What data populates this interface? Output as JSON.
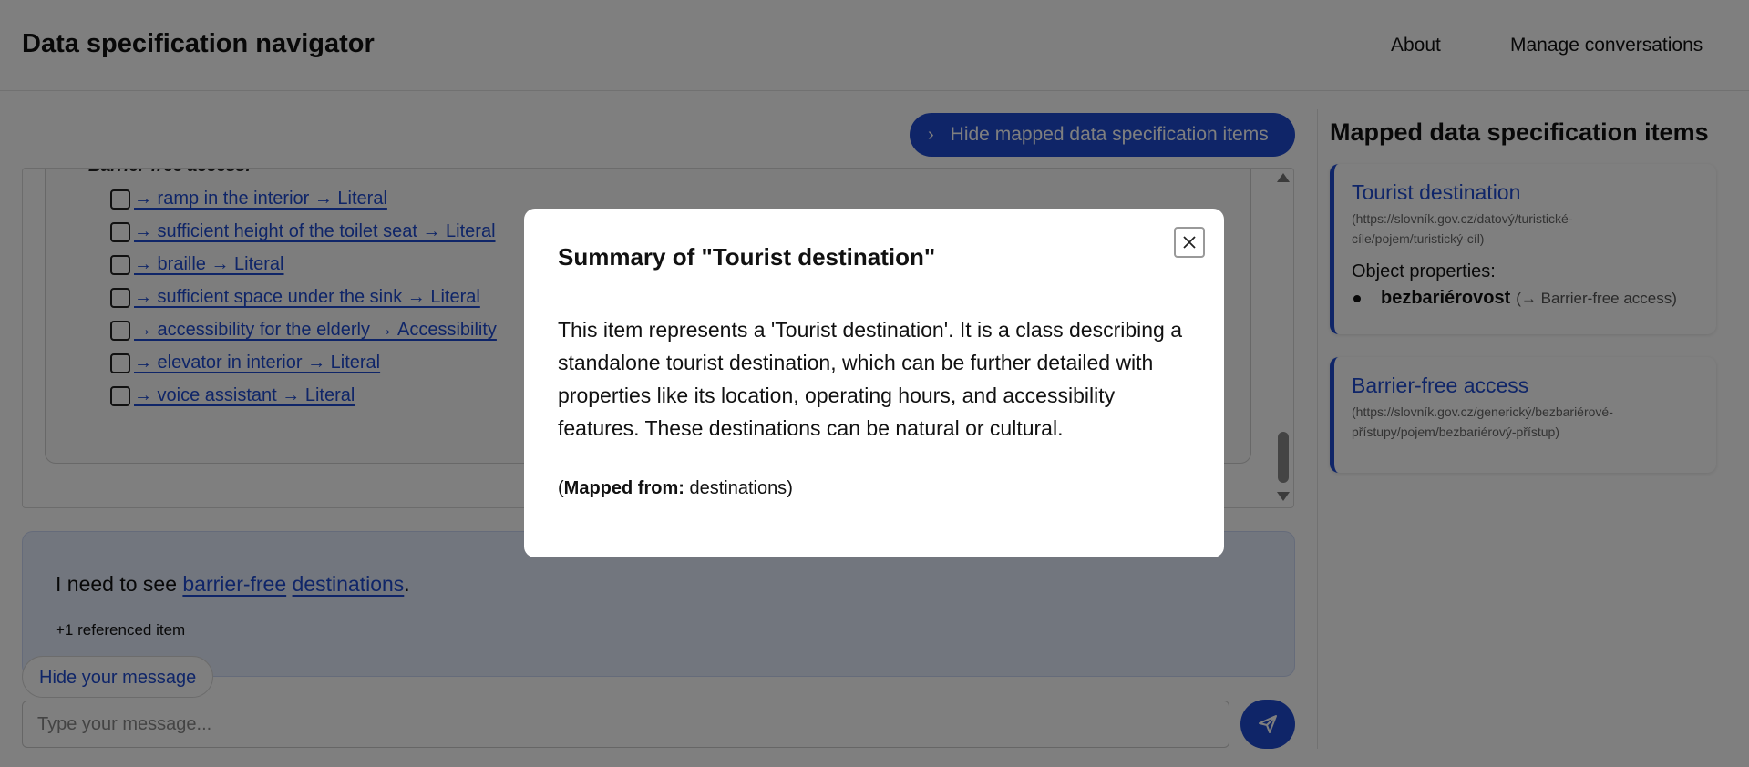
{
  "header": {
    "title": "Data specification navigator",
    "nav": {
      "about": "About",
      "manage": "Manage conversations"
    }
  },
  "toolbar": {
    "hide_mapped_label": "Hide mapped data specification items"
  },
  "chat": {
    "group_heading": "Barrier-free access:",
    "items": [
      "→ ramp in the interior → Literal",
      "→ sufficient height of the toilet seat → Literal",
      "→ braille → Literal",
      "→ sufficient space under the sink → Literal",
      "→ accessibility for the elderly → Accessibility",
      "→ elevator in interior → Literal",
      "→ voice assistant → Literal"
    ]
  },
  "user_message": {
    "prefix": "I need to see ",
    "link1": "barrier-free",
    "space": " ",
    "link2": "destinations",
    "suffix": ".",
    "ref_count": "+1 referenced item",
    "hide_label": "Hide your message"
  },
  "input": {
    "placeholder": "Type your message..."
  },
  "sidebar": {
    "title": "Mapped data specification items",
    "cards": [
      {
        "title": "Tourist destination",
        "url": "(https://slovník.gov.cz/datový/turistické-cíle/pojem/turistický-cíl)",
        "subheading": "Object properties:",
        "property": "bezbariérovost",
        "property_target": "(→ Barrier-free access)"
      },
      {
        "title": "Barrier-free access",
        "url": "(https://slovník.gov.cz/generický/bezbariérové-přístupy/pojem/bezbariérový-přístup)"
      }
    ]
  },
  "modal": {
    "title": "Summary of \"Tourist destination\"",
    "body": "This item represents a 'Tourist destination'. It is a class describing a standalone tourist destination, which can be further detailed with properties like its location, operating hours, and accessibility features. These destinations can be natural or cultural.",
    "mapped_open": "(",
    "mapped_label": "Mapped from:",
    "mapped_value": " destinations",
    "mapped_close": ")"
  },
  "colors": {
    "accent": "#1f4bd1",
    "message_bg": "#e4ecfc",
    "overlay": "rgba(0,0,0,0.5)"
  },
  "icons": {
    "toggle": "chevron-right-icon",
    "send": "send-icon",
    "close": "close-icon"
  }
}
